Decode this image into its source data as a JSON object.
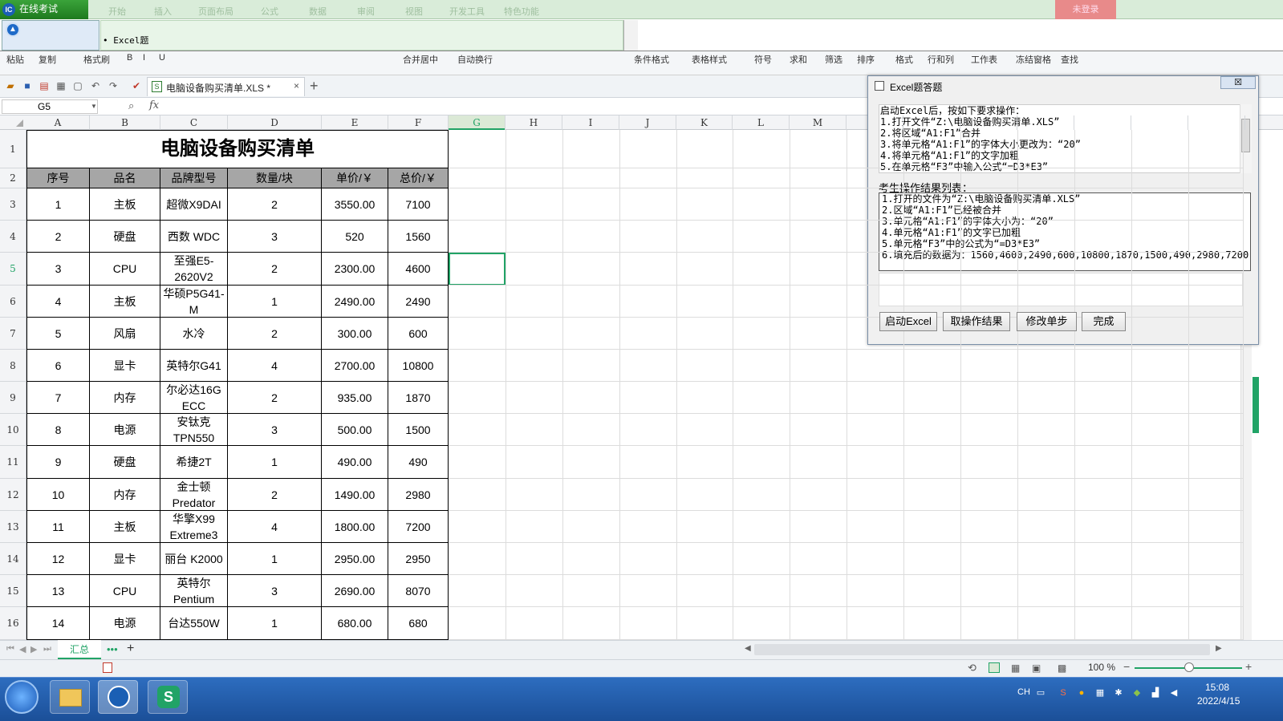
{
  "exam": {
    "title": "在线考试",
    "logo": "IC",
    "ghost_tabs": [
      "开始",
      "插入",
      "页面布局",
      "公式",
      "数据",
      "审阅",
      "视图",
      "开发工具",
      "特色功能"
    ],
    "red_button": "未登录"
  },
  "question": {
    "label": "• Excel题"
  },
  "ribbon": {
    "items": [
      "粘贴",
      "复制",
      "格式刷",
      "B",
      "I",
      "U",
      "合并居中",
      "自动换行",
      "条件格式",
      "表格样式",
      "符号",
      "求和",
      "筛选",
      "排序",
      "格式",
      "行和列",
      "工作表",
      "冻结窗格",
      "查找"
    ]
  },
  "toolbar": {
    "doc_name": "电脑设备购买清单.XLS *",
    "close": "×",
    "add": "+"
  },
  "formula_bar": {
    "cell_ref": "G5",
    "fx": "fx"
  },
  "sheet": {
    "columns": [
      "A",
      "B",
      "C",
      "D",
      "E",
      "F",
      "G",
      "H",
      "I",
      "J",
      "K",
      "L",
      "M"
    ],
    "title": "电脑设备购买清单",
    "headers": [
      "序号",
      "品名",
      "品牌型号",
      "数量/块",
      "单价/￥",
      "总价/￥"
    ],
    "rows": [
      [
        "1",
        "主板",
        "超微X9DAI",
        "2",
        "3550.00",
        "7100"
      ],
      [
        "2",
        "硬盘",
        "西数 WDC",
        "3",
        "520",
        "1560"
      ],
      [
        "3",
        "CPU",
        "至强E5-2620V2",
        "2",
        "2300.00",
        "4600"
      ],
      [
        "4",
        "主板",
        "华硕P5G41-M",
        "1",
        "2490.00",
        "2490"
      ],
      [
        "5",
        "风扇",
        "水冷",
        "2",
        "300.00",
        "600"
      ],
      [
        "6",
        "显卡",
        "英特尔G41",
        "4",
        "2700.00",
        "10800"
      ],
      [
        "7",
        "内存",
        "尔必达16G ECC",
        "2",
        "935.00",
        "1870"
      ],
      [
        "8",
        "电源",
        "安钛克TPN550",
        "3",
        "500.00",
        "1500"
      ],
      [
        "9",
        "硬盘",
        "希捷2T",
        "1",
        "490.00",
        "490"
      ],
      [
        "10",
        "内存",
        "金士顿Predator",
        "2",
        "1490.00",
        "2980"
      ],
      [
        "11",
        "主板",
        "华擎X99 Extreme3",
        "4",
        "1800.00",
        "7200"
      ],
      [
        "12",
        "显卡",
        "丽台 K2000",
        "1",
        "2950.00",
        "2950"
      ],
      [
        "13",
        "CPU",
        "英特尔Pentium",
        "3",
        "2690.00",
        "8070"
      ],
      [
        "14",
        "电源",
        "台达550W",
        "1",
        "680.00",
        "680"
      ]
    ],
    "row_numbers": [
      "1",
      "2",
      "3",
      "4",
      "5",
      "6",
      "7",
      "8",
      "9",
      "10",
      "11",
      "12",
      "13",
      "14",
      "15",
      "16"
    ],
    "tab": "汇总",
    "tab_more": "•••",
    "add_sheet": "+"
  },
  "status": {
    "zoom": "100 %"
  },
  "dialog": {
    "title": "Excel题答题",
    "close": "☒",
    "instructions": [
      "启动Excel后，按如下要求操作：",
      "1.打开文件“Z:\\电脑设备购买清单.XLS”",
      "2.将区域“A1:F1”合并",
      "3.将单元格“A1:F1”的字体大小更改为：“20”",
      "4.将单元格“A1:F1”的文字加粗",
      "5.在单元格“F3”中输入公式“=D3*E3”"
    ],
    "result_label": "考生操作结果列表：",
    "results": [
      "1.打开的文件为“Z:\\电脑设备购买清单.XLS”",
      "2.区域“A1:F1”已经被合并",
      "3.单元格“A1:F1”的字体大小为：“20”",
      "4.单元格“A1:F1”的文字已加粗",
      "5.单元格“F3”中的公式为“=D3*E3”",
      "6.填充后的数据为：1560,4600,2490,600,10800,1870,1500,490,2980,7200,"
    ],
    "buttons": [
      "启动Excel",
      "取操作结果",
      "修改单步",
      "完成"
    ]
  },
  "taskbar": {
    "time": "15:08",
    "date": "2022/4/15",
    "lang": "CH"
  },
  "colors": {
    "accent": "#21a366",
    "header_fill": "#a6a6a6",
    "taskbar": "#1b4f98"
  }
}
